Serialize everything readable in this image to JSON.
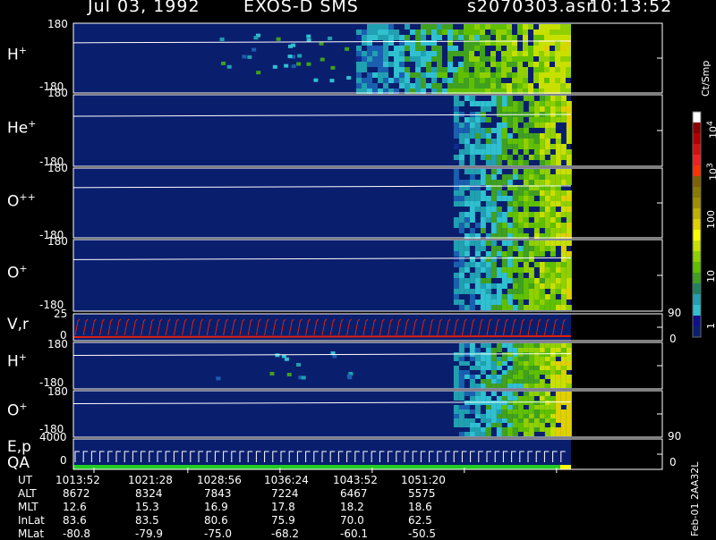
{
  "header": {
    "date": "Jul 03, 1992",
    "instrument": "EXOS-D SMS",
    "file": "s2070303.asr",
    "time": "10:13:52"
  },
  "colors": {
    "background": "#000000",
    "panel_fill": "#0a1e6e",
    "ephemeris_line": "#ffffff",
    "velocity_line": "#e02010",
    "qa_bar": "#22cc22"
  },
  "panels": [
    {
      "id": "hp1",
      "label_base": "H",
      "label_sup": "+",
      "ymax": "180",
      "ymin": "-180"
    },
    {
      "id": "hep",
      "label_base": "He",
      "label_sup": "+",
      "ymax": "180",
      "ymin": "-180"
    },
    {
      "id": "opp",
      "label_base": "O",
      "label_sup": "++",
      "ymax": "180",
      "ymin": "-180"
    },
    {
      "id": "op1",
      "label_base": "O",
      "label_sup": "+",
      "ymax": "180",
      "ymin": "-180"
    },
    {
      "id": "vr",
      "label_base": "V,r",
      "label_sup": "",
      "ymax": "25",
      "ymin": "0",
      "right_max": "90",
      "right_min": "0"
    },
    {
      "id": "hp2",
      "label_base": "H",
      "label_sup": "+",
      "ymax": "180",
      "ymin": "-180"
    },
    {
      "id": "op2",
      "label_base": "O",
      "label_sup": "+",
      "ymax": "180",
      "ymin": "-180"
    },
    {
      "id": "ep",
      "label_base": "E,p",
      "label_sup": "",
      "label2": "QA",
      "ymax": "4000",
      "ymin": "0",
      "right_max": "90",
      "right_min": "0"
    }
  ],
  "colorbar": {
    "unit": "Ct/Smp",
    "tick_labels": [
      "10",
      "10",
      "100",
      "10",
      "1"
    ],
    "tick_sups": [
      "4",
      "3",
      "",
      "",
      ""
    ],
    "colors": [
      "#ffffff",
      "#8b0000",
      "#b00000",
      "#d01010",
      "#ee2020",
      "#ff3000",
      "#806000",
      "#8a7a00",
      "#a09000",
      "#c0b000",
      "#e0d000",
      "#ffff00",
      "#c8e000",
      "#90d000",
      "#60c000",
      "#40a020",
      "#208060",
      "#20a0b0",
      "#30c0d0",
      "#10108a",
      "#0a1e6e"
    ]
  },
  "ephemeris": {
    "row_labels": [
      "UT",
      "ALT",
      "MLT",
      "InLat",
      "MLat"
    ],
    "columns": [
      [
        "1013:52",
        "8672",
        "12.6",
        "83.6",
        "-80.8"
      ],
      [
        "1021:28",
        "8324",
        "15.3",
        "83.5",
        "-79.9"
      ],
      [
        "1028:56",
        "7843",
        "16.9",
        "80.6",
        "-75.0"
      ],
      [
        "1036:24",
        "7224",
        "17.8",
        "75.9",
        "-68.2"
      ],
      [
        "1043:52",
        "6467",
        "18.2",
        "70.0",
        "-60.1"
      ],
      [
        "1051:20",
        "5575",
        "18.6",
        "62.5",
        "-50.5"
      ]
    ]
  },
  "footer_id": "Feb-01 2AA32L",
  "chart_data": {
    "type": "heatmap",
    "title": "Jul 03, 1992   EXOS-D SMS",
    "x": [
      "1013:52",
      "1021:28",
      "1028:56",
      "1036:24",
      "1043:52",
      "1051:20"
    ],
    "xlabel": "UT",
    "ylim_angle": [
      -180,
      180
    ],
    "ylim_velocity": [
      0,
      25
    ],
    "ylim_energy": [
      0,
      4000
    ],
    "ylim_right_axes": [
      0,
      90
    ],
    "colorbar_range_ct_per_smp": [
      1,
      10000
    ],
    "colorbar_scale": "log",
    "data_end_ut": "1052:30",
    "active_region_start_ut": "1043:00"
  }
}
